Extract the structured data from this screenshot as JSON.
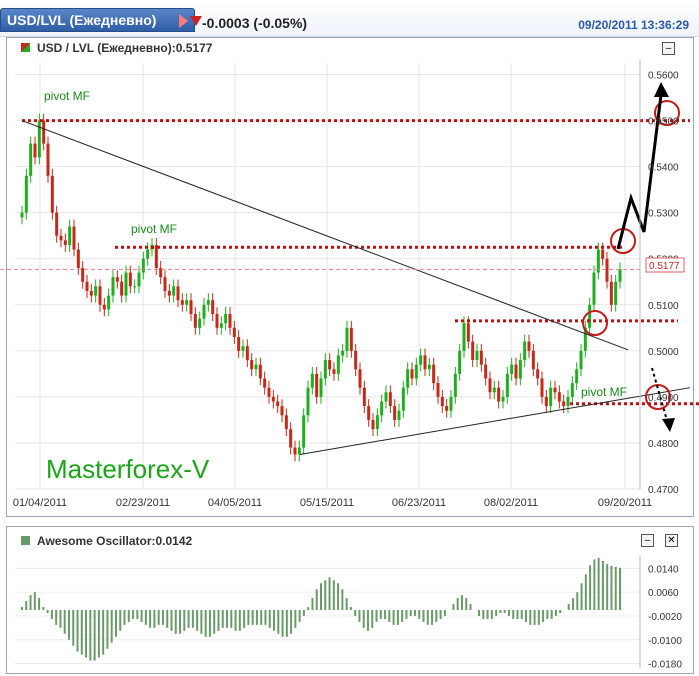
{
  "header": {
    "symbol_tab": "USD/LVL (Ежедневно)",
    "change": "-0.0003 (-0.05%)",
    "timestamp": "09/20/2011 13:36:29"
  },
  "main_panel": {
    "title": "USD / LVL (Ежедневно):0.5177",
    "last_price_label": "0.5177",
    "minimize": "–"
  },
  "oscillator_panel": {
    "title": "Awesome Oscillator:0.0142",
    "minimize": "–",
    "close": "✕"
  },
  "colors": {
    "up_candle": "#1fae1f",
    "down_candle": "#c42a1a",
    "pivot_line": "#bb1111",
    "oscillator": "#6a9a6a",
    "tab": "#2f5ea6"
  },
  "annotations": {
    "pivot_1": "pivot MF",
    "pivot_2": "pivot MF",
    "pivot_3": "pivot MF",
    "watermark": "Masterforex-V"
  },
  "chart_data": [
    {
      "type": "candlestick",
      "x_tick_labels": [
        "01/04/2011",
        "02/23/2011",
        "04/05/2011",
        "05/15/2011",
        "06/23/2011",
        "08/02/2011",
        "09/20/2011"
      ],
      "y_tick_labels": [
        "0.5600",
        "0.5500",
        "0.5400",
        "0.5300",
        "0.5200",
        "0.5100",
        "0.5000",
        "0.4900",
        "0.4800",
        "0.4700"
      ],
      "ylim": [
        0.47,
        0.5625
      ],
      "last": 0.5177,
      "grid": true,
      "closes": [
        0.53,
        0.538,
        0.545,
        0.542,
        0.55,
        0.545,
        0.538,
        0.53,
        0.525,
        0.524,
        0.523,
        0.527,
        0.522,
        0.518,
        0.515,
        0.513,
        0.512,
        0.514,
        0.51,
        0.509,
        0.512,
        0.516,
        0.515,
        0.512,
        0.517,
        0.514,
        0.514,
        0.517,
        0.52,
        0.522,
        0.523,
        0.518,
        0.516,
        0.513,
        0.512,
        0.514,
        0.511,
        0.51,
        0.511,
        0.508,
        0.505,
        0.507,
        0.51,
        0.511,
        0.508,
        0.505,
        0.506,
        0.508,
        0.505,
        0.503,
        0.5,
        0.501,
        0.498,
        0.496,
        0.497,
        0.494,
        0.492,
        0.49,
        0.489,
        0.488,
        0.486,
        0.483,
        0.479,
        0.4775,
        0.479,
        0.486,
        0.492,
        0.495,
        0.49,
        0.494,
        0.498,
        0.496,
        0.495,
        0.499,
        0.5,
        0.505,
        0.5,
        0.496,
        0.492,
        0.488,
        0.485,
        0.483,
        0.486,
        0.489,
        0.491,
        0.488,
        0.485,
        0.487,
        0.492,
        0.496,
        0.494,
        0.497,
        0.499,
        0.496,
        0.497,
        0.493,
        0.49,
        0.488,
        0.487,
        0.49,
        0.495,
        0.5,
        0.506,
        0.502,
        0.498,
        0.5,
        0.497,
        0.494,
        0.491,
        0.492,
        0.489,
        0.49,
        0.495,
        0.497,
        0.494,
        0.498,
        0.502,
        0.5,
        0.496,
        0.494,
        0.49,
        0.488,
        0.492,
        0.491,
        0.489,
        0.488,
        0.49,
        0.493,
        0.496,
        0.5,
        0.505,
        0.51,
        0.517,
        0.522,
        0.52,
        0.515,
        0.51,
        0.515,
        0.5177
      ],
      "pivot_levels": [
        0.55,
        0.5225,
        0.5065,
        0.4885
      ],
      "oscillator": {
        "name": "Awesome Oscillator",
        "last": 0.0142,
        "y_tick_labels": [
          "0.0140",
          "0.0060",
          "-0.0020",
          "-0.0100",
          "-0.0180"
        ],
        "ylim": [
          -0.0195,
          0.0185
        ],
        "values": [
          0.001,
          0.003,
          0.005,
          0.006,
          0.004,
          0.001,
          -0.001,
          -0.003,
          -0.005,
          -0.006,
          -0.008,
          -0.01,
          -0.012,
          -0.014,
          -0.015,
          -0.016,
          -0.017,
          -0.017,
          -0.016,
          -0.015,
          -0.013,
          -0.011,
          -0.009,
          -0.007,
          -0.005,
          -0.004,
          -0.003,
          -0.003,
          -0.004,
          -0.005,
          -0.006,
          -0.006,
          -0.005,
          -0.005,
          -0.006,
          -0.007,
          -0.008,
          -0.008,
          -0.007,
          -0.006,
          -0.006,
          -0.007,
          -0.008,
          -0.009,
          -0.009,
          -0.008,
          -0.007,
          -0.006,
          -0.006,
          -0.006,
          -0.007,
          -0.007,
          -0.006,
          -0.005,
          -0.005,
          -0.005,
          -0.005,
          -0.005,
          -0.006,
          -0.007,
          -0.008,
          -0.009,
          -0.009,
          -0.008,
          -0.006,
          -0.004,
          -0.002,
          0.001,
          0.004,
          0.007,
          0.009,
          0.01,
          0.011,
          0.01,
          0.009,
          0.007,
          0.004,
          0.001,
          -0.002,
          -0.004,
          -0.006,
          -0.007,
          -0.006,
          -0.004,
          -0.003,
          -0.003,
          -0.004,
          -0.005,
          -0.005,
          -0.004,
          -0.003,
          -0.002,
          -0.002,
          -0.003,
          -0.004,
          -0.005,
          -0.005,
          -0.004,
          -0.003,
          -0.002,
          0.0,
          0.002,
          0.004,
          0.005,
          0.004,
          0.002,
          0.0,
          -0.002,
          -0.003,
          -0.003,
          -0.003,
          -0.002,
          -0.001,
          -0.001,
          -0.002,
          -0.003,
          -0.003,
          -0.003,
          -0.004,
          -0.005,
          -0.005,
          -0.005,
          -0.004,
          -0.003,
          -0.003,
          -0.002,
          -0.001,
          0.0,
          0.002,
          0.004,
          0.006,
          0.009,
          0.012,
          0.015,
          0.017,
          0.0175,
          0.0165,
          0.0155,
          0.0148,
          0.0145,
          0.0142
        ]
      }
    }
  ]
}
